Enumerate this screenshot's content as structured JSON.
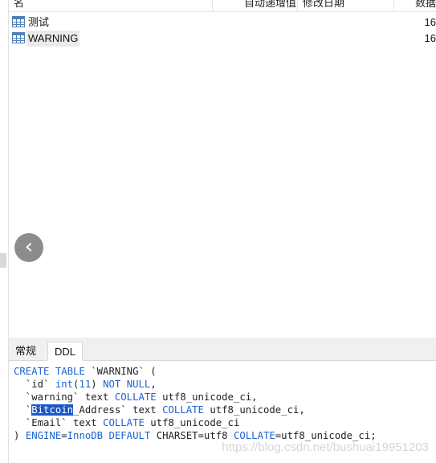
{
  "columns": {
    "name": "名",
    "auto_increment": "自动递增值",
    "modified_date": "修改日期",
    "data": "数据"
  },
  "rows": [
    {
      "name": "测试",
      "value": "16"
    },
    {
      "name": "WARNING",
      "value": "16"
    }
  ],
  "tabs": {
    "general": "常规",
    "ddl": "DDL"
  },
  "ddl": {
    "l1_kw": "CREATE TABLE",
    "l1_rest": " `WARNING` (",
    "l2_a": "  `id` ",
    "l2_type": "int",
    "l2_p1": "(",
    "l2_len": "11",
    "l2_p2": ") ",
    "l2_kw": "NOT NULL",
    "l2_end": ",",
    "l3_a": "  `warning` text ",
    "l3_kw": "COLLATE",
    "l3_end": " utf8_unicode_ci,",
    "l4_a": "  `",
    "l4_sel": "Bitcoin",
    "l4_b": "_Address` text ",
    "l4_kw": "COLLATE",
    "l4_end": " utf8_unicode_ci,",
    "l5_a": "  `Email` text ",
    "l5_kw": "COLLATE",
    "l5_end": " utf8_unicode_ci",
    "l6_a": ") ",
    "l6_kw1": "ENGINE",
    "l6_b": "=",
    "l6_kw2": "InnoDB DEFAULT",
    "l6_c": " CHARSET=utf8 ",
    "l6_kw3": "COLLATE",
    "l6_d": "=utf8_unicode_ci;"
  },
  "watermark": "https://blog.csdn.net/bushuai19951203",
  "icons": {
    "table": "table-icon",
    "back": "chevron-left-icon"
  }
}
